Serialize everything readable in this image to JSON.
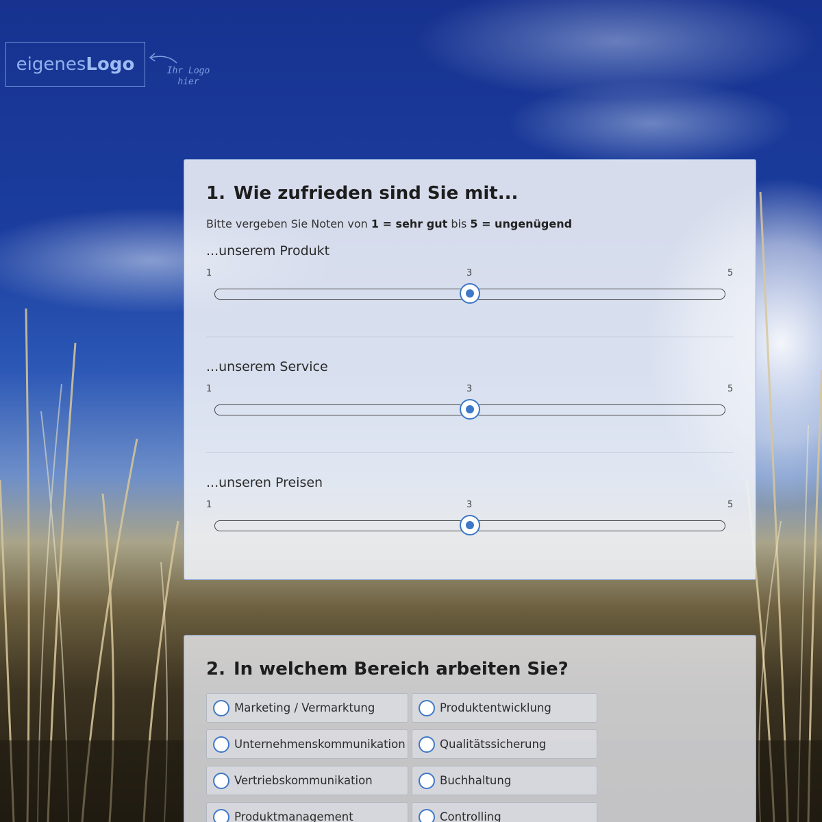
{
  "logo": {
    "text_regular": "eigenes",
    "text_bold": "Logo",
    "hint_line1": "Ihr Logo",
    "hint_line2": "hier"
  },
  "question1": {
    "number": "1.",
    "title": "Wie zufrieden sind Sie mit...",
    "subtitle_prefix": "Bitte vergeben Sie Noten von ",
    "subtitle_bold1": "1 = sehr gut",
    "subtitle_mid": " bis ",
    "subtitle_bold2": "5 = ungenügend",
    "items": [
      {
        "label": "...unserem Produkt",
        "min": "1",
        "mid": "3",
        "max": "5",
        "value": 3
      },
      {
        "label": "...unserem Service",
        "min": "1",
        "mid": "3",
        "max": "5",
        "value": 3
      },
      {
        "label": "...unseren Preisen",
        "min": "1",
        "mid": "3",
        "max": "5",
        "value": 3
      }
    ]
  },
  "question2": {
    "number": "2.",
    "title": "In welchem Bereich arbeiten Sie?",
    "options": [
      "Marketing / Vermarktung",
      "Produktentwicklung",
      "Unternehmenskommunikation",
      "Qualitätssicherung",
      "Vertriebskommunikation",
      "Buchhaltung",
      "Produktmanagement",
      "Controlling"
    ]
  },
  "colors": {
    "accent": "#3e78c6",
    "logo": "#8fb2ef"
  }
}
